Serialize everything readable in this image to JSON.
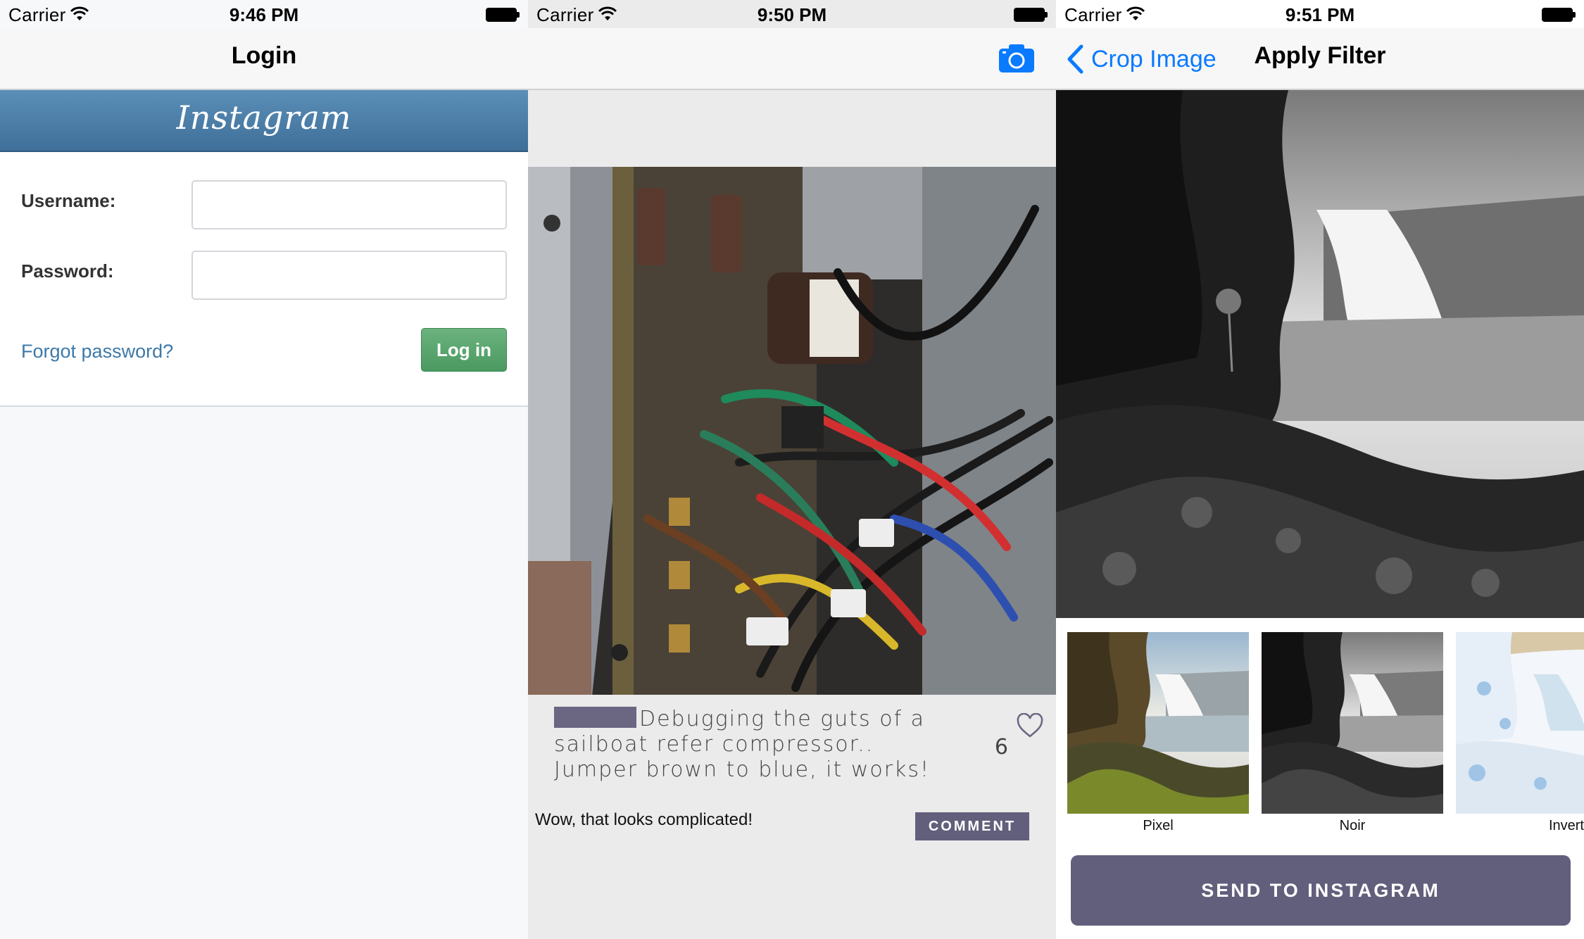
{
  "login_screen": {
    "status": {
      "carrier": "Carrier",
      "time": "9:46 PM"
    },
    "title": "Login",
    "brand": "Instagram",
    "username_label": "Username:",
    "username_value": "",
    "password_label": "Password:",
    "password_value": "",
    "forgot_password": "Forgot password?",
    "login_button": "Log in",
    "colors": {
      "header": "#4a7ca6",
      "button": "#56a26b",
      "link": "#3d79a8"
    }
  },
  "feed_screen": {
    "status": {
      "carrier": "Carrier",
      "time": "9:50 PM"
    },
    "camera_icon": "camera-icon",
    "post": {
      "caption": "Debugging the guts of a sailboat refer compressor.. Jumper brown to blue, it works!",
      "like_count": "6",
      "comment": "Wow, that looks complicated!",
      "comment_button": "COMMENT"
    },
    "colors": {
      "accent": "#625f7c",
      "icon": "#0a7aff"
    }
  },
  "filter_screen": {
    "status": {
      "carrier": "Carrier",
      "time": "9:51 PM"
    },
    "back_label": "Crop Image",
    "title": "Apply Filter",
    "filters": [
      {
        "label": "Pixel"
      },
      {
        "label": "Noir"
      },
      {
        "label": "Invert"
      }
    ],
    "send_button": "SEND TO INSTAGRAM",
    "colors": {
      "back": "#0a7aff",
      "button": "#625f7c"
    }
  }
}
